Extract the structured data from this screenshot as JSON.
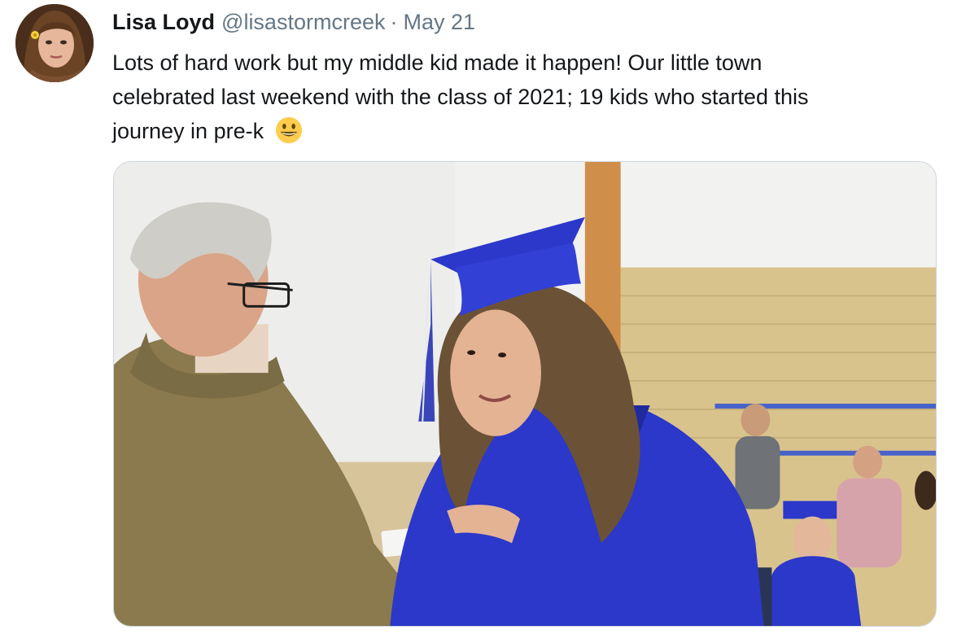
{
  "tweet": {
    "author": {
      "display_name": "Lisa Loyd",
      "handle": "@lisastormcreek",
      "avatar_icon": "profile-photo"
    },
    "separator": "·",
    "date": "May 21",
    "text_lines": [
      "Lots of hard work but my middle kid made it happen! Our little town",
      "celebrated last weekend with the class of 2021; 19 kids who started this",
      "journey in pre-k"
    ],
    "emoji_icon": "grinning-face-emoji",
    "media": {
      "type": "photo",
      "colors": {
        "gown_blue": "#2b38c9",
        "jacket_tan": "#8a7a4e",
        "brick_wall": "#d9c38c",
        "white_wall": "#ececea"
      }
    }
  }
}
